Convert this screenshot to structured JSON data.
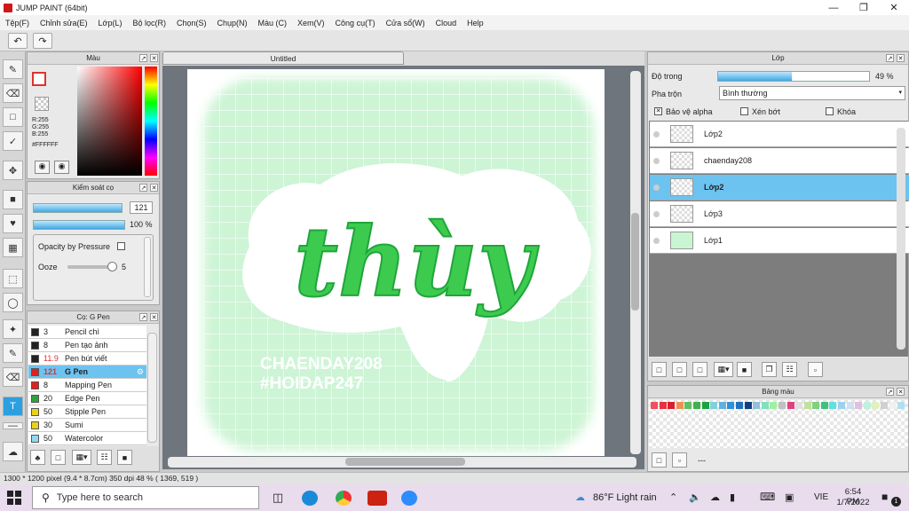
{
  "window": {
    "title": "JUMP PAINT (64bit)"
  },
  "menu": [
    "Tệp(F)",
    "Chỉnh sửa(E)",
    "Lớp(L)",
    "Bộ lọc(R)",
    "Chọn(S)",
    "Chụp(N)",
    "Màu (C)",
    "Xem(V)",
    "Công cụ(T)",
    "Cửa sổ(W)",
    "Cloud",
    "Help"
  ],
  "color_panel": {
    "title": "Màu",
    "r": "R:255",
    "g": "G:255",
    "b": "B:255",
    "hex": "#FFFFFF"
  },
  "brush_control": {
    "title": "Kiểm soát cọ",
    "size": "121",
    "opacity": "100 %",
    "opacity_fill": 1.0,
    "size_fill": 0.97,
    "pressure_label": "Opacity by Pressure",
    "ooze_label": "Ooze",
    "ooze_value": "5",
    "ooze_fill": 0.9
  },
  "brush_list": {
    "title": "Cọ: G Pen",
    "items": [
      {
        "size": "3",
        "name": "Pencil chì",
        "color": "#222222"
      },
      {
        "size": "8",
        "name": "Pen tạo ảnh",
        "color": "#222222"
      },
      {
        "size": "11.9",
        "name": "Pen bút viết",
        "color": "#222222"
      },
      {
        "size": "121",
        "name": "G Pen",
        "color": "#e02020"
      },
      {
        "size": "8",
        "name": "Mapping Pen",
        "color": "#e02020"
      },
      {
        "size": "20",
        "name": "Edge Pen",
        "color": "#2fa33a"
      },
      {
        "size": "50",
        "name": "Stipple Pen",
        "color": "#e8d21c"
      },
      {
        "size": "30",
        "name": "Sumi",
        "color": "#e8d21c"
      },
      {
        "size": "50",
        "name": "Watercolor",
        "color": "#8fd8f0"
      }
    ]
  },
  "canvas": {
    "tab_title": "Untitled",
    "artwork_text": "thùy",
    "sub1": "CHAENDAY208",
    "sub2": "#HOIDAP247"
  },
  "layer_panel": {
    "title": "Lớp",
    "opacity_label": "Độ trong",
    "opacity_value": "49 %",
    "opacity_fill": 0.49,
    "blend_label": "Pha trộn",
    "blend_value": "Bình thường",
    "protect_alpha": "Bảo vệ alpha",
    "clip": "Xén bớt",
    "lock": "Khóa",
    "layers": [
      {
        "name": "Lớp2"
      },
      {
        "name": "chaenday208"
      },
      {
        "name": "Lớp2"
      },
      {
        "name": "Lớp3"
      },
      {
        "name": "Lớp1"
      }
    ]
  },
  "palette": {
    "title": "Bảng màu",
    "colors": [
      "#f05060",
      "#e83040",
      "#d82030",
      "#f09050",
      "#60c060",
      "#40b050",
      "#20a040",
      "#80d0e0",
      "#60b0e0",
      "#3090d8",
      "#2070c0",
      "#104080",
      "#90c0e0",
      "#80e0c0",
      "#a0f0a0",
      "#c0c0c0",
      "#e04080",
      "#e0e0e0",
      "#c0e0a0",
      "#80d080",
      "#40c080",
      "#60e0e0",
      "#a0d0f0",
      "#d0e0f0",
      "#e0c0e0",
      "#c0f0e0",
      "#e0f0c0",
      "#d0d0d0",
      "#f0f0f0",
      "#b0e0f0"
    ],
    "dash": "---"
  },
  "status": {
    "text": "1300 * 1200 pixel   (9.4 * 8.7cm)   350 dpi   48 %   ( 1369, 519 )"
  },
  "taskbar": {
    "search": "Type here to search",
    "weather": "86°F  Light rain",
    "lang": "VIE",
    "time": "6:54 PM",
    "date": "1/7/2022",
    "badge": "1"
  }
}
